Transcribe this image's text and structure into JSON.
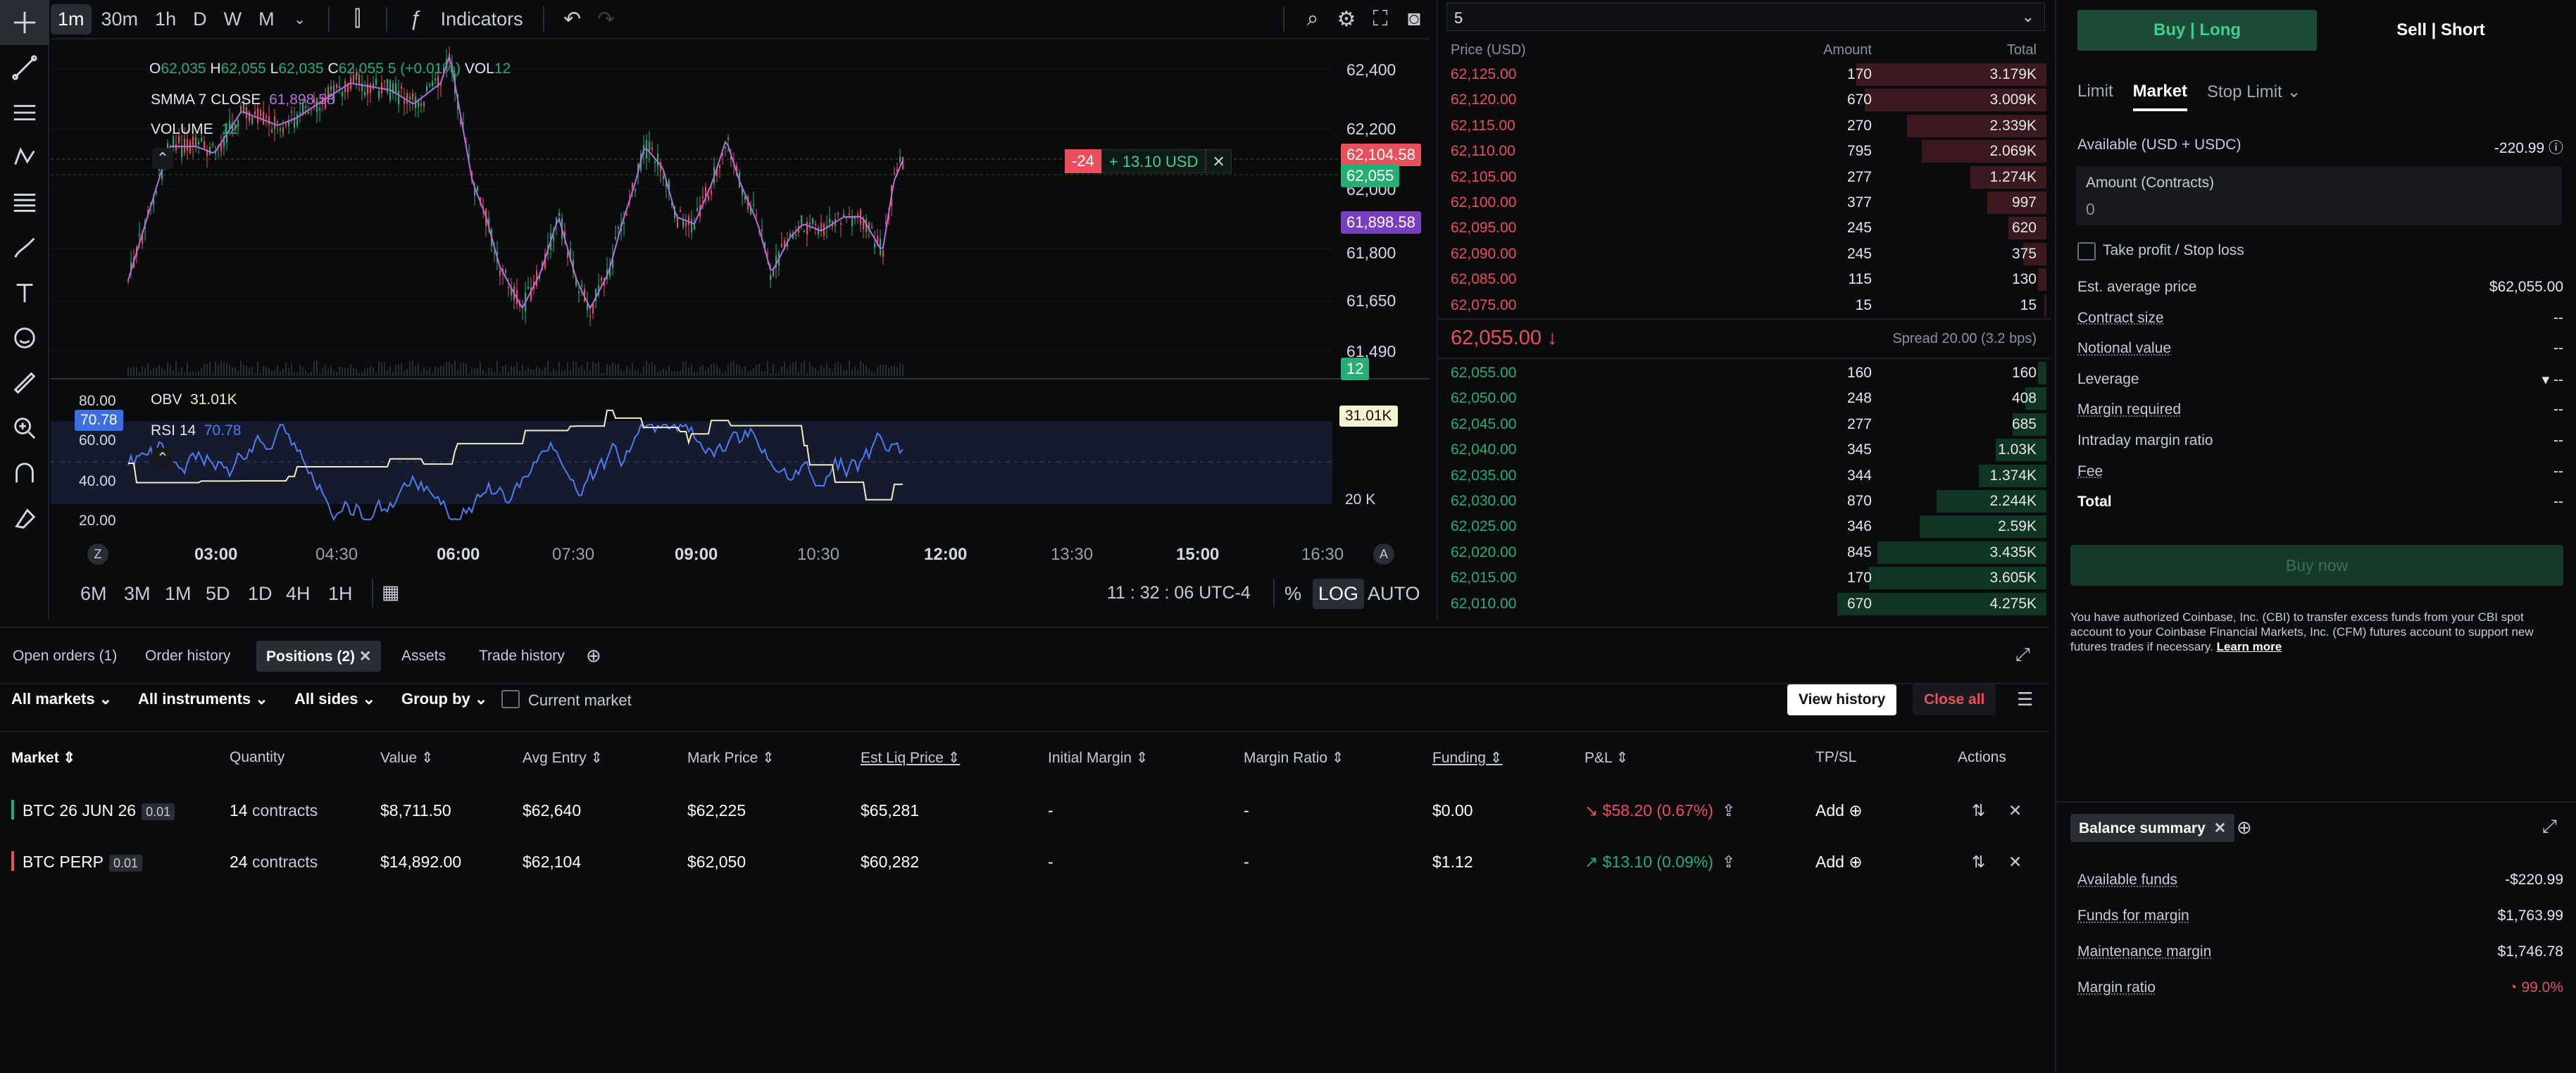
{
  "toolbar": {
    "timeframes": [
      "1m",
      "30m",
      "1h",
      "D",
      "W",
      "M"
    ],
    "indicators_label": "Indicators"
  },
  "chart": {
    "ohlc": {
      "o_label": "O",
      "o": "62,035",
      "h_label": "H",
      "h": "62,055",
      "l_label": "L",
      "l": "62,035",
      "c_label": "C",
      "c": "62,055",
      "change": "5 (+0.01%)",
      "vol_label": "VOL",
      "vol": "12"
    },
    "smma": {
      "label": "SMMA 7 CLOSE",
      "value": "61,898.58"
    },
    "volume": {
      "label": "VOLUME",
      "value": "12"
    },
    "y_labels": [
      "62,400",
      "62,200",
      "62,000",
      "61,800",
      "61,650",
      "61,490"
    ],
    "position_tag": {
      "qty": "-24",
      "pnl": "+ 13.10 USD"
    },
    "price_tags": {
      "red": "62,104.58",
      "green": "62,055",
      "purple": "61,898.58",
      "vol": "12"
    },
    "indicator": {
      "obv_label": "OBV",
      "obv_value": "31.01K",
      "rsi_label": "RSI 14",
      "rsi_value": "70.78",
      "levels": [
        "80.00",
        "60.00",
        "40.00",
        "20.00"
      ],
      "rsi_tag": "70.78",
      "obv_tag": "31.01K",
      "obv_axis": "20 K"
    },
    "x_labels": [
      {
        "t": "03:00",
        "bold": true
      },
      {
        "t": "04:30",
        "bold": false
      },
      {
        "t": "06:00",
        "bold": true
      },
      {
        "t": "07:30",
        "bold": false
      },
      {
        "t": "09:00",
        "bold": true
      },
      {
        "t": "10:30",
        "bold": false
      },
      {
        "t": "12:00",
        "bold": true
      },
      {
        "t": "13:30",
        "bold": false
      },
      {
        "t": "15:00",
        "bold": true
      },
      {
        "t": "16:30",
        "bold": false
      }
    ],
    "bottom_timeframes": [
      "6M",
      "3M",
      "1M",
      "5D",
      "1D",
      "4H",
      "1H"
    ],
    "clock": "11 : 32 : 06 UTC-4",
    "scale_opts": [
      "%",
      "LOG",
      "AUTO"
    ],
    "z_btn": "Z",
    "a_btn": "A"
  },
  "orderbook": {
    "agg": "5",
    "headers": {
      "price": "Price (USD)",
      "amount": "Amount",
      "total": "Total"
    },
    "asks": [
      {
        "price": "62,125.00",
        "amount": "170",
        "total": "3.179K",
        "depth": 0.9
      },
      {
        "price": "62,120.00",
        "amount": "670",
        "total": "3.009K",
        "depth": 0.86
      },
      {
        "price": "62,115.00",
        "amount": "270",
        "total": "2.339K",
        "depth": 0.66
      },
      {
        "price": "62,110.00",
        "amount": "795",
        "total": "2.069K",
        "depth": 0.59
      },
      {
        "price": "62,105.00",
        "amount": "277",
        "total": "1.274K",
        "depth": 0.36
      },
      {
        "price": "62,100.00",
        "amount": "377",
        "total": "997",
        "depth": 0.28
      },
      {
        "price": "62,095.00",
        "amount": "245",
        "total": "620",
        "depth": 0.18
      },
      {
        "price": "62,090.00",
        "amount": "245",
        "total": "375",
        "depth": 0.11
      },
      {
        "price": "62,085.00",
        "amount": "115",
        "total": "130",
        "depth": 0.04
      },
      {
        "price": "62,075.00",
        "amount": "15",
        "total": "15",
        "depth": 0.01
      }
    ],
    "mid_price": "62,055.00 ↓",
    "spread": "Spread 20.00 (3.2 bps)",
    "bids": [
      {
        "price": "62,055.00",
        "amount": "160",
        "total": "160",
        "depth": 0.04
      },
      {
        "price": "62,050.00",
        "amount": "248",
        "total": "408",
        "depth": 0.1
      },
      {
        "price": "62,045.00",
        "amount": "277",
        "total": "685",
        "depth": 0.16
      },
      {
        "price": "62,040.00",
        "amount": "345",
        "total": "1.03K",
        "depth": 0.24
      },
      {
        "price": "62,035.00",
        "amount": "344",
        "total": "1.374K",
        "depth": 0.32
      },
      {
        "price": "62,030.00",
        "amount": "870",
        "total": "2.244K",
        "depth": 0.52
      },
      {
        "price": "62,025.00",
        "amount": "346",
        "total": "2.59K",
        "depth": 0.6
      },
      {
        "price": "62,020.00",
        "amount": "845",
        "total": "3.435K",
        "depth": 0.8
      },
      {
        "price": "62,015.00",
        "amount": "170",
        "total": "3.605K",
        "depth": 0.84
      },
      {
        "price": "62,010.00",
        "amount": "670",
        "total": "4.275K",
        "depth": 0.99
      }
    ]
  },
  "order_form": {
    "buy_label": "Buy | Long",
    "sell_label": "Sell | Short",
    "tabs": [
      "Limit",
      "Market",
      "Stop Limit"
    ],
    "available_label": "Available (USD + USDC)",
    "available_value": "-220.99",
    "amount_label": "Amount (Contracts)",
    "amount_placeholder": "0",
    "tpsl_label": "Take profit / Stop loss",
    "rows": [
      {
        "k": "Est. average price",
        "v": "$62,055.00",
        "u": false
      },
      {
        "k": "Contract size",
        "v": "--",
        "u": true
      },
      {
        "k": "Notional value",
        "v": "--",
        "u": true
      },
      {
        "k": "Leverage",
        "v": "--",
        "u": false
      },
      {
        "k": "Margin required",
        "v": "--",
        "u": true
      },
      {
        "k": "Intraday margin ratio",
        "v": "--",
        "u": false
      },
      {
        "k": "Fee",
        "v": "--",
        "u": true
      },
      {
        "k": "Total",
        "v": "--",
        "u": false
      }
    ],
    "buy_now": "Buy now",
    "disclaimer": "You have authorized Coinbase, Inc. (CBI) to transfer excess funds from your CBI spot account to your Coinbase Financial Markets, Inc. (CFM) futures account to support new futures trades if necessary.",
    "learn_more": "Learn more"
  },
  "balance": {
    "tab": "Balance summary",
    "rows": [
      {
        "k": "Available funds",
        "v": "-$220.99"
      },
      {
        "k": "Funds for margin",
        "v": "$1,763.99"
      },
      {
        "k": "Maintenance margin",
        "v": "$1,746.78"
      },
      {
        "k": "Margin ratio",
        "v": "99.0%"
      }
    ]
  },
  "bottom": {
    "tabs": [
      "Open orders (1)",
      "Order history",
      "Positions (2)",
      "Assets",
      "Trade history"
    ],
    "filters": {
      "markets": "All markets",
      "instruments": "All instruments",
      "sides": "All sides",
      "group": "Group by",
      "current": "Current market"
    },
    "view_history": "View history",
    "close_all": "Close all",
    "headers": [
      "Market",
      "Quantity",
      "Value",
      "Avg Entry",
      "Mark Price",
      "Est Liq Price",
      "Initial Margin",
      "Margin Ratio",
      "Funding",
      "P&L",
      "TP/SL",
      "Actions"
    ],
    "rows": [
      {
        "market": "BTC 26 JUN 26",
        "badge": "0.01",
        "qty": "14",
        "unit": "contracts",
        "value": "$8,711.50",
        "avg": "$62,640",
        "mark": "$62,225",
        "liq": "$65,281",
        "im": "-",
        "mr": "-",
        "funding": "$0.00",
        "pnl": "↘ $58.20 (0.67%)",
        "tpsl": "Add",
        "color": "#27ad75",
        "pnlcolor": "#e8505b"
      },
      {
        "market": "BTC PERP",
        "badge": "0.01",
        "qty": "24",
        "unit": "contracts",
        "value": "$14,892.00",
        "avg": "$62,104",
        "mark": "$62,050",
        "liq": "$60,282",
        "im": "-",
        "mr": "-",
        "funding": "$1.12",
        "pnl": "↗ $13.10 (0.09%)",
        "tpsl": "Add",
        "color": "#e8505b",
        "pnlcolor": "#27ad75"
      }
    ]
  }
}
